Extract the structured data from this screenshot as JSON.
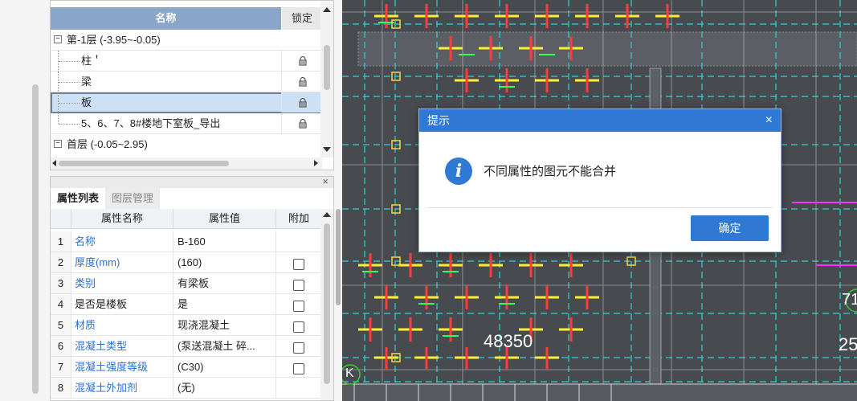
{
  "layer_tree": {
    "header_name": "名称",
    "header_lock": "锁定",
    "rows": [
      {
        "label": "第-1层 (-3.95~-0.05)",
        "expander": "−"
      },
      {
        "label": "柱＇"
      },
      {
        "label": "梁"
      },
      {
        "label": "板"
      },
      {
        "label": "5、6、7、8#楼地下室板_导出"
      },
      {
        "label": "首层 (-0.05~2.95)",
        "expander": "−"
      }
    ]
  },
  "property_panel": {
    "close": "×",
    "tabs": [
      {
        "label": "属性列表"
      },
      {
        "label": "图层管理"
      }
    ],
    "columns": {
      "name": "属性名称",
      "value": "属性值",
      "extra": "附加"
    },
    "rows": [
      {
        "n": "1",
        "name": "名称",
        "value": "B-160"
      },
      {
        "n": "2",
        "name": "厚度(mm)",
        "value": "(160)"
      },
      {
        "n": "3",
        "name": "类别",
        "value": "有梁板"
      },
      {
        "n": "4",
        "name": "是否是楼板",
        "value": "是"
      },
      {
        "n": "5",
        "name": "材质",
        "value": "现浇混凝土"
      },
      {
        "n": "6",
        "name": "混凝土类型",
        "value": "(泵送混凝土 碎..."
      },
      {
        "n": "7",
        "name": "混凝土强度等级",
        "value": "(C30)"
      },
      {
        "n": "8",
        "name": "混凝土外加剂",
        "value": "(无)"
      }
    ]
  },
  "canvas": {
    "dimension_label": "48350",
    "edge_labels": [
      "71",
      "25",
      "K"
    ]
  },
  "dialog": {
    "title": "提示",
    "close": "×",
    "icon": "i",
    "message": "不同属性的图元不能合并",
    "ok_label": "确定"
  },
  "colors": {
    "accent": "#2f78d4",
    "canvas_bg": "#474a4f",
    "header": "#8aa6c9"
  }
}
